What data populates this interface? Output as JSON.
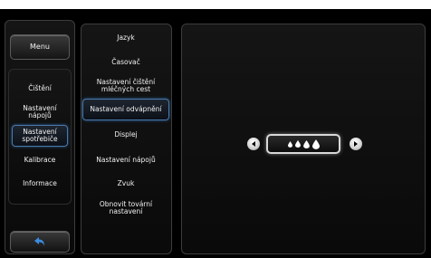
{
  "left_menu": {
    "menu_label": "Menu",
    "items": [
      {
        "label": "Čištění"
      },
      {
        "label": "Nastavení nápojů"
      },
      {
        "label": "Nastavení spotřebiče"
      },
      {
        "label": "Kalibrace"
      },
      {
        "label": "Informace"
      }
    ],
    "back_icon": "undo-arrow-icon"
  },
  "settings_menu": {
    "items": [
      {
        "label": "Jazyk"
      },
      {
        "label": "Časovač"
      },
      {
        "label": "Nastavení čištění mléčných cest"
      },
      {
        "label": "Nastavení odvápnění"
      },
      {
        "label": "Displej"
      },
      {
        "label": "Nastavení nápojů"
      },
      {
        "label": "Zvuk"
      },
      {
        "label": "Obnovit tovární nastavení"
      }
    ]
  },
  "detail": {
    "water_hardness_level": 4,
    "drop_icon": "water-drop-icon",
    "decrease_icon": "arrow-left-icon",
    "increase_icon": "arrow-right-icon"
  },
  "colors": {
    "background": "#000000",
    "selection": "#4a78a8",
    "accent_blue": "#3a8de0"
  }
}
